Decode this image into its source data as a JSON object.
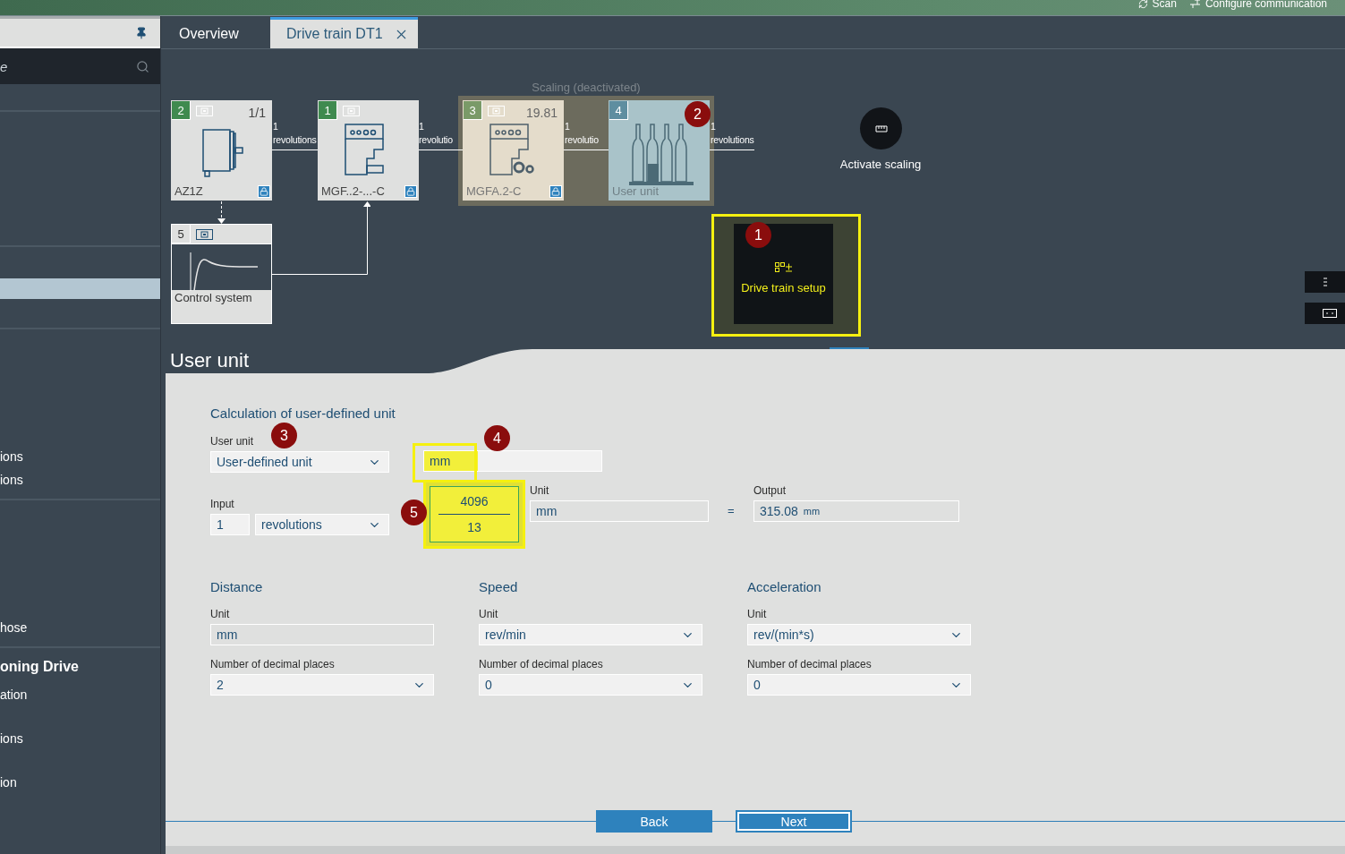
{
  "top_bar": {
    "actions": [
      {
        "kind": "scan",
        "label": "Scan"
      },
      {
        "kind": "connect",
        "label": "Configure communication"
      }
    ]
  },
  "sidebar": {
    "search": {
      "placeholder": "e"
    },
    "items": [
      {
        "selected": true
      },
      {
        "label": "ions",
        "selected": false,
        "bold": false
      },
      {
        "label": "ions",
        "selected": false,
        "bold": false
      },
      {
        "label": "hose",
        "selected": false,
        "bold": false
      },
      {
        "label": "oning Drive",
        "selected": false,
        "bold": true
      },
      {
        "label": "ation",
        "selected": false,
        "bold": false
      },
      {
        "label": "ions",
        "selected": false,
        "bold": false
      },
      {
        "label": "ion",
        "selected": false,
        "bold": false
      }
    ]
  },
  "tabs": [
    {
      "label": "Overview",
      "selected": false,
      "closable": false
    },
    {
      "label": "Drive train DT1",
      "selected": true,
      "closable": true
    }
  ],
  "diagram": {
    "group_label": "Scaling (deactivated)",
    "nodes": [
      {
        "kind": "motor",
        "number": "2",
        "ratio": "1/1",
        "label": "AZ1Z",
        "locked": true
      },
      {
        "kind": "gear_unit",
        "number": "1",
        "label": "MGF..2-...-C",
        "locked": true
      },
      {
        "kind": "gear_scaled",
        "number": "3",
        "ratio": "19.81",
        "label": "MGFA.2-C",
        "locked": true
      },
      {
        "kind": "user_unit",
        "number": "4",
        "label": "User unit",
        "locked": false,
        "marker": "2"
      },
      {
        "kind": "control",
        "number": "5",
        "label": "Control system",
        "locked": false
      }
    ],
    "links": [
      {
        "value": "1",
        "unit": "revolutions"
      },
      {
        "value": "1",
        "unit": "revolutio"
      },
      {
        "value": "1",
        "unit": "revolutio"
      },
      {
        "value": "1",
        "unit": "revolutions"
      }
    ],
    "activate": {
      "label": "Activate scaling"
    },
    "setup": {
      "label": "Drive train setup",
      "marker": "1",
      "highlighted": true
    }
  },
  "panel": {
    "title": "User unit",
    "heading": "Calculation of user-defined unit",
    "user_unit": {
      "label": "User unit",
      "value": "User-defined unit",
      "marker": "3"
    },
    "custom_unit": {
      "value": "mm",
      "marker": "4",
      "highlighted": true
    },
    "input": {
      "label": "Input",
      "value": "1",
      "unit": "revolutions"
    },
    "factor": {
      "numerator": "4096",
      "denominator": "13",
      "marker": "5",
      "highlighted": true
    },
    "unit": {
      "label": "Unit",
      "value": "mm"
    },
    "equals": "=",
    "output": {
      "label": "Output",
      "value": "315.08",
      "unit": "mm"
    },
    "sections": [
      {
        "title": "Distance",
        "unit_label": "Unit",
        "unit": "mm",
        "dropdown": false,
        "decimals_label": "Number of decimal places",
        "decimals": "2"
      },
      {
        "title": "Speed",
        "unit_label": "Unit",
        "unit": "rev/min",
        "dropdown": true,
        "decimals_label": "Number of decimal places",
        "decimals": "0"
      },
      {
        "title": "Acceleration",
        "unit_label": "Unit",
        "unit": "rev/(min*s)",
        "dropdown": true,
        "decimals_label": "Number of decimal places",
        "decimals": "0"
      }
    ],
    "buttons": [
      {
        "label": "Back",
        "focused": false
      },
      {
        "label": "Next",
        "focused": true
      }
    ]
  }
}
